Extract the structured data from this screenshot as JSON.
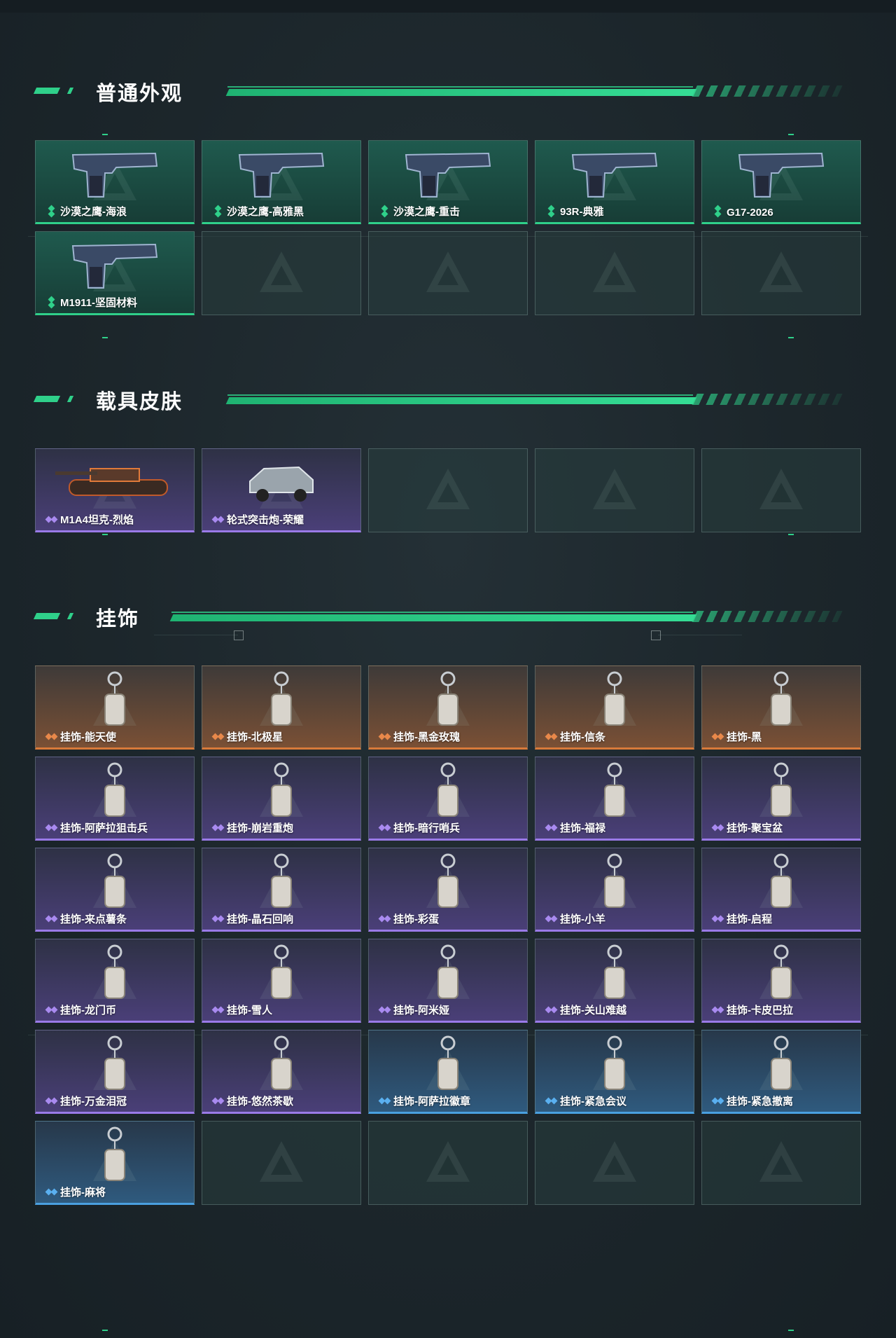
{
  "sections": [
    {
      "title": "普通外观",
      "items": [
        {
          "label": "沙漠之鹰-海浪",
          "rarity": "green",
          "icon": "pistol-icon"
        },
        {
          "label": "沙漠之鹰-高雅黑",
          "rarity": "green",
          "icon": "pistol-icon"
        },
        {
          "label": "沙漠之鹰-重击",
          "rarity": "green",
          "icon": "pistol-icon"
        },
        {
          "label": "93R-典雅",
          "rarity": "green",
          "icon": "pistol-icon"
        },
        {
          "label": "G17-2026",
          "rarity": "green",
          "icon": "pistol-icon"
        },
        {
          "label": "M1911-坚固材料",
          "rarity": "green",
          "icon": "pistol-icon"
        }
      ]
    },
    {
      "title": "载具皮肤",
      "items": [
        {
          "label": "M1A4坦克-烈焰",
          "rarity": "purple",
          "icon": "tank-icon"
        },
        {
          "label": "轮式突击炮-荣耀",
          "rarity": "purple",
          "icon": "armored-vehicle-icon"
        }
      ]
    },
    {
      "title": "挂饰",
      "items": [
        {
          "label": "挂饰-能天使",
          "rarity": "orange",
          "icon": "charm-icon"
        },
        {
          "label": "挂饰-北极星",
          "rarity": "orange",
          "icon": "charm-icon"
        },
        {
          "label": "挂饰-黑金玫瑰",
          "rarity": "orange",
          "icon": "charm-icon"
        },
        {
          "label": "挂饰-信条",
          "rarity": "orange",
          "icon": "charm-icon"
        },
        {
          "label": "挂饰-黑",
          "rarity": "orange",
          "icon": "charm-icon"
        },
        {
          "label": "挂饰-阿萨拉狙击兵",
          "rarity": "purple",
          "icon": "charm-icon"
        },
        {
          "label": "挂饰-崩岩重炮",
          "rarity": "purple",
          "icon": "charm-icon"
        },
        {
          "label": "挂饰-暗行哨兵",
          "rarity": "purple",
          "icon": "charm-icon"
        },
        {
          "label": "挂饰-福禄",
          "rarity": "purple",
          "icon": "charm-icon"
        },
        {
          "label": "挂饰-聚宝盆",
          "rarity": "purple",
          "icon": "charm-icon"
        },
        {
          "label": "挂饰-来点薯条",
          "rarity": "purple",
          "icon": "charm-icon"
        },
        {
          "label": "挂饰-晶石回响",
          "rarity": "purple",
          "icon": "charm-icon"
        },
        {
          "label": "挂饰-彩蛋",
          "rarity": "purple",
          "icon": "charm-icon"
        },
        {
          "label": "挂饰-小羊",
          "rarity": "purple",
          "icon": "charm-icon"
        },
        {
          "label": "挂饰-启程",
          "rarity": "purple",
          "icon": "charm-icon"
        },
        {
          "label": "挂饰-龙门币",
          "rarity": "purple",
          "icon": "charm-icon"
        },
        {
          "label": "挂饰-雪人",
          "rarity": "purple",
          "icon": "charm-icon"
        },
        {
          "label": "挂饰-阿米娅",
          "rarity": "purple",
          "icon": "charm-icon"
        },
        {
          "label": "挂饰-关山难越",
          "rarity": "purple",
          "icon": "charm-icon"
        },
        {
          "label": "挂饰-卡皮巴拉",
          "rarity": "purple",
          "icon": "charm-icon"
        },
        {
          "label": "挂饰-万金泪冠",
          "rarity": "purple",
          "icon": "charm-icon"
        },
        {
          "label": "挂饰-悠然茶歇",
          "rarity": "purple",
          "icon": "charm-icon"
        },
        {
          "label": "挂饰-阿萨拉徽章",
          "rarity": "blue",
          "icon": "charm-icon"
        },
        {
          "label": "挂饰-紧急会议",
          "rarity": "blue",
          "icon": "charm-icon"
        },
        {
          "label": "挂饰-紧急撤离",
          "rarity": "blue",
          "icon": "charm-icon"
        },
        {
          "label": "挂饰-麻将",
          "rarity": "blue",
          "icon": "charm-icon"
        }
      ]
    }
  ],
  "colors": {
    "accent": "#2fd08a",
    "rarity_green": "#2fd08a",
    "rarity_purple": "#9a7ae8",
    "rarity_orange": "#d87a3a",
    "rarity_blue": "#4aa0e0"
  }
}
